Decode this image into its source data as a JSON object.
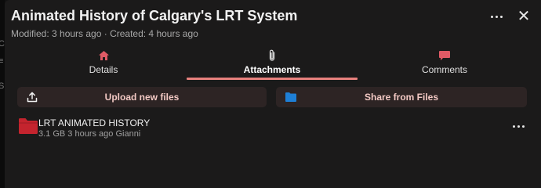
{
  "panel": {
    "title": "Animated History of Calgary's LRT System",
    "meta": "Modified: 3 hours ago · Created: 4 hours ago",
    "more_icon": "more-horizontal-icon",
    "close_label": "✕"
  },
  "tabs": [
    {
      "label": "Details",
      "icon": "home-icon",
      "active": false
    },
    {
      "label": "Attachments",
      "icon": "paperclip-icon",
      "active": true
    },
    {
      "label": "Comments",
      "icon": "comment-icon",
      "active": false
    }
  ],
  "actions": {
    "upload_label": "Upload new files",
    "upload_icon": "upload-icon",
    "share_label": "Share from Files",
    "share_icon": "folder-icon"
  },
  "files": [
    {
      "name": "LRT ANIMATED HISTORY",
      "info": "3.1 GB 3 hours ago Gianni",
      "icon": "folder-icon"
    }
  ],
  "colors": {
    "accent": "#e8817d",
    "tab_icon": "#e05a65",
    "folder_red": "#c4242e",
    "folder_blue": "#1e7fd6",
    "button_bg": "#2d2424",
    "button_text": "#f3c9c4"
  }
}
